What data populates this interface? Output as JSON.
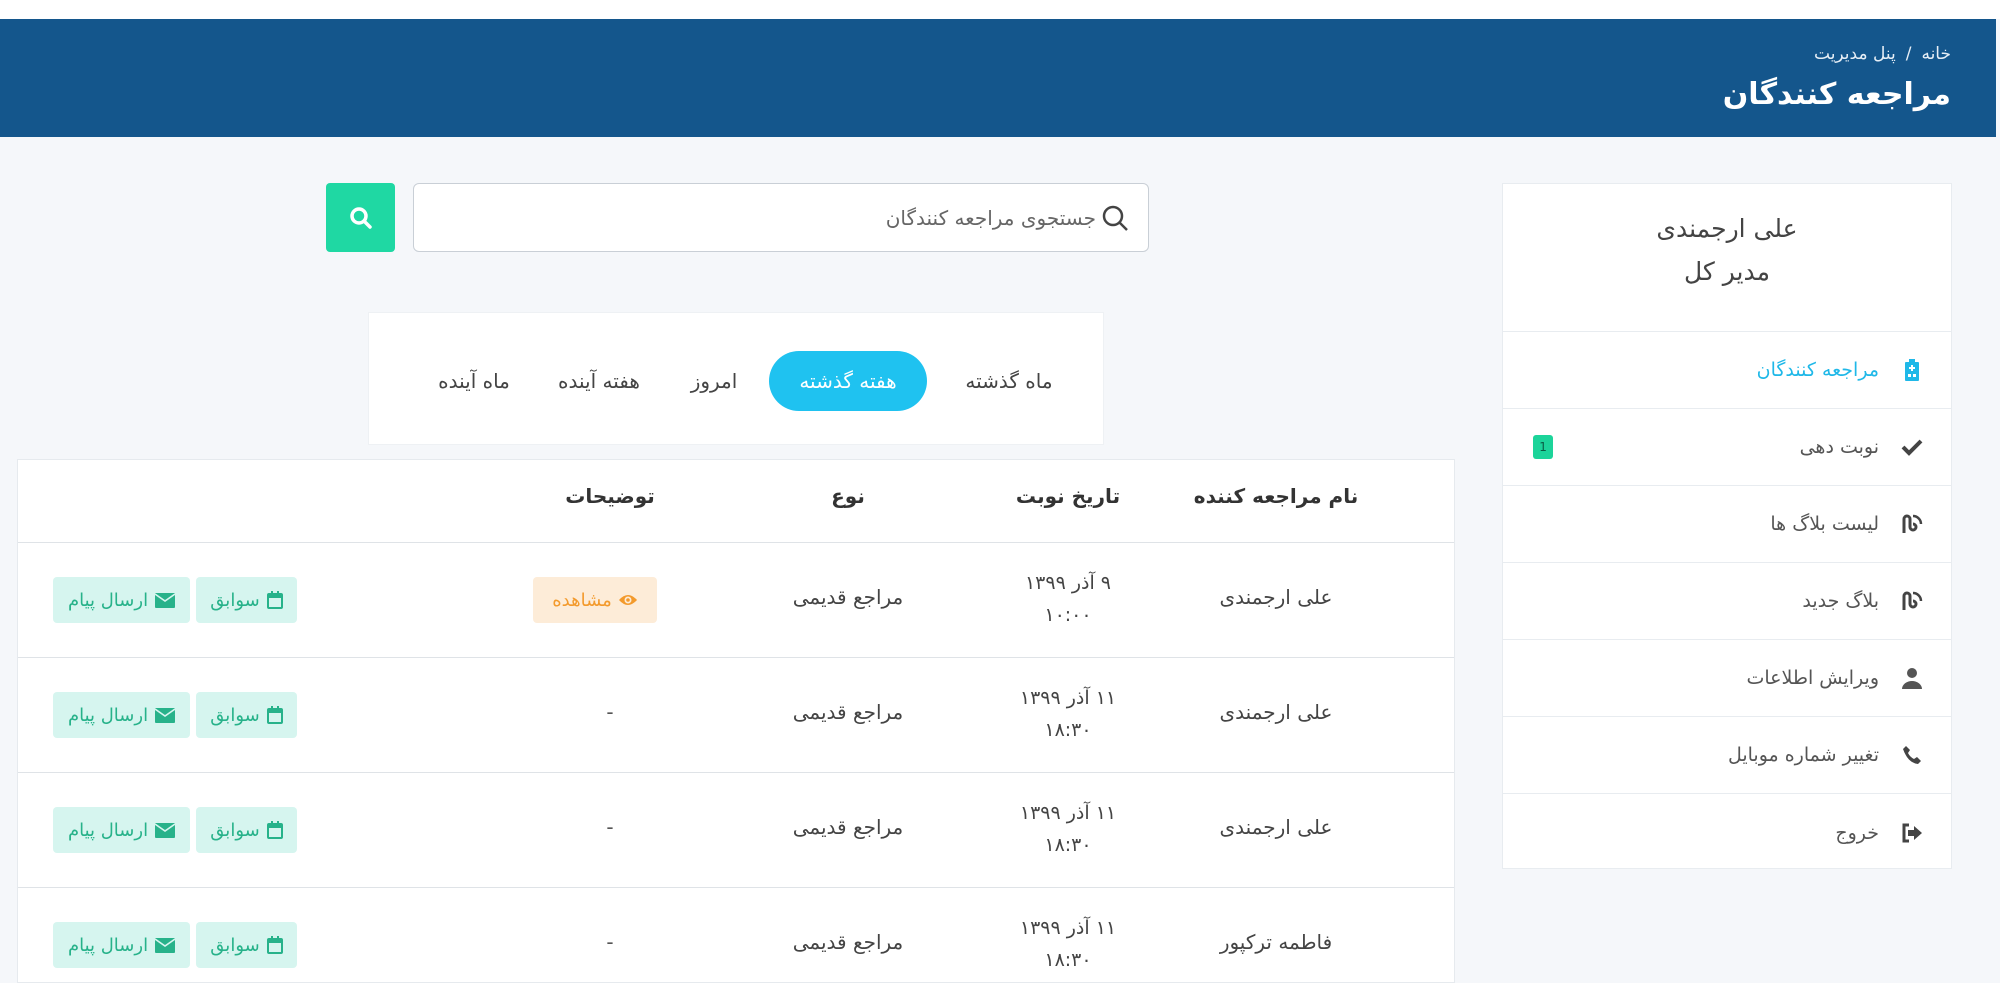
{
  "header": {
    "breadcrumb_home": "خانه",
    "breadcrumb_sep": "/",
    "breadcrumb_current": "پنل مدیریت",
    "title": "مراجعه کنندگان"
  },
  "profile": {
    "name": "علی ارجمندی",
    "role": "مدیر کل"
  },
  "sidebar": {
    "items": [
      {
        "label": "مراجعه کنندگان",
        "icon": "hospital-icon",
        "active": true
      },
      {
        "label": "نوبت دهی",
        "icon": "check-icon",
        "badge": "1"
      },
      {
        "label": "لیست بلاگ ها",
        "icon": "blog-icon"
      },
      {
        "label": "بلاگ جدید",
        "icon": "blog-icon"
      },
      {
        "label": "ویرایش اطلاعات",
        "icon": "user-icon"
      },
      {
        "label": "تغییر شماره موبایل",
        "icon": "phone-icon"
      },
      {
        "label": "خروج",
        "icon": "logout-icon"
      }
    ]
  },
  "search": {
    "placeholder": "جستجوی مراجعه کنندگان",
    "value": ""
  },
  "tabs": [
    {
      "label": "ماه گذشته"
    },
    {
      "label": "هفته گذشته",
      "active": true
    },
    {
      "label": "امروز"
    },
    {
      "label": "هفته آینده"
    },
    {
      "label": "ماه آینده"
    }
  ],
  "table": {
    "columns": [
      "نام مراجعه کننده",
      "تاریخ نوبت",
      "نوع",
      "توضیحات"
    ],
    "rows": [
      {
        "name": "علی ارجمندی",
        "date": "۹ آذر ۱۳۹۹",
        "time": "۱۰:۰۰",
        "type": "مراجع قدیمی",
        "desc": "",
        "view_label": "مشاهده",
        "history_label": "سوابق",
        "message_label": "ارسال پیام"
      },
      {
        "name": "علی ارجمندی",
        "date": "۱۱ آذر ۱۳۹۹",
        "time": "۱۸:۳۰",
        "type": "مراجع قدیمی",
        "desc": "-",
        "history_label": "سوابق",
        "message_label": "ارسال پیام"
      },
      {
        "name": "علی ارجمندی",
        "date": "۱۱ آذر ۱۳۹۹",
        "time": "۱۸:۳۰",
        "type": "مراجع قدیمی",
        "desc": "-",
        "history_label": "سوابق",
        "message_label": "ارسال پیام"
      },
      {
        "name": "فاطمه ترکپور",
        "date": "۱۱ آذر ۱۳۹۹",
        "time": "۱۸:۳۰",
        "type": "مراجع قدیمی",
        "desc": "-",
        "history_label": "سوابق",
        "message_label": "ارسال پیام"
      }
    ]
  },
  "colors": {
    "header_bg": "#14568c",
    "accent_cyan": "#1fc2f0",
    "accent_green": "#1fd8a3",
    "view_orange": "#f39a2c"
  }
}
